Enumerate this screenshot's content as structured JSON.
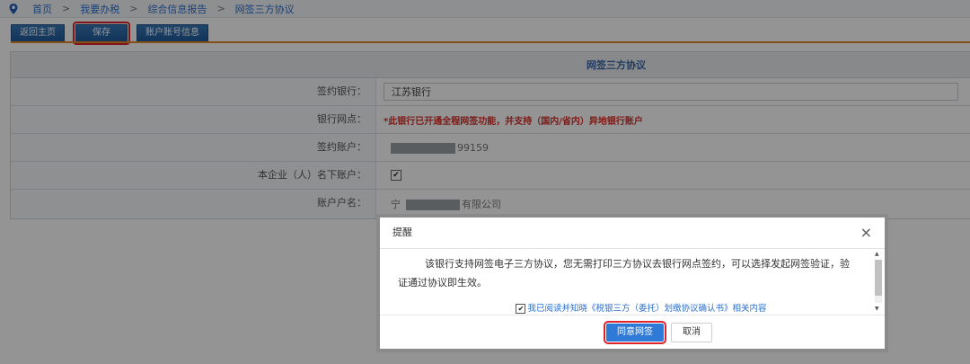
{
  "breadcrumb": [
    "首页",
    "我要办税",
    "综合信息报告",
    "网签三方协议"
  ],
  "breadcrumb_sep": ">",
  "toolbar": {
    "home": "返回主页",
    "save": "保存",
    "account_info": "账户账号信息"
  },
  "form": {
    "title": "网签三方协议",
    "rows": [
      {
        "label": "签约银行：",
        "value": "江苏银行"
      },
      {
        "label": "银行网点：",
        "value": "*此银行已开通全程网签功能，并支持（国内/省内）异地银行账户"
      },
      {
        "label": "签约账户：",
        "value": "99159"
      },
      {
        "label": "本企业（人）名下账户：",
        "value": "✔"
      },
      {
        "label": "账户户名：",
        "value_prefix": "宁",
        "value": "有限公司"
      }
    ]
  },
  "dialog": {
    "title": "提醒",
    "close": "×",
    "message": "该银行支持网签电子三方协议，您无需打印三方协议去银行网点签约，可以选择发起网签验证，验证通过协议即生效。",
    "agree_check": "✔",
    "agree_text": "我已阅读并知晓《税银三方（委托）划缴协议确认书》相关内容",
    "confirm": "同意网签",
    "cancel": "取消"
  },
  "colors": {
    "accent": "#2f7ad6",
    "highlight": "#e0232b",
    "toolbar": "#1f5a97",
    "divider": "#e48a2a"
  }
}
